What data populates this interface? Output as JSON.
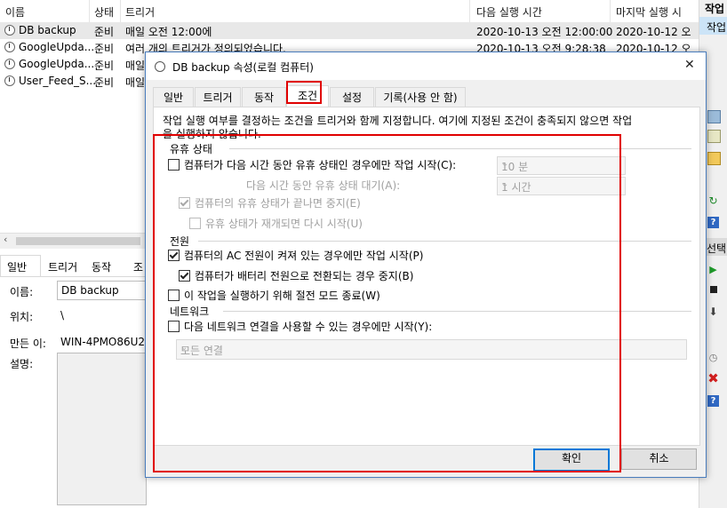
{
  "task_list": {
    "columns": [
      "이름",
      "상태",
      "트리거",
      "다음 실행 시간",
      "마지막 실행 시"
    ],
    "rows": [
      {
        "name": "DB backup",
        "status": "준비",
        "trigger": "매일 오전 12:00에",
        "next_run": "2020-10-13 오전 12:00:00",
        "last_run": "2020-10-12 오"
      },
      {
        "name": "GoogleUpda...",
        "status": "준비",
        "trigger": "여러 개의 트리거가 정의되었습니다.",
        "next_run": "2020-10-13 오전 9:28:38",
        "last_run": "2020-10-12 오"
      },
      {
        "name": "GoogleUpda...",
        "status": "준비",
        "trigger": "매일",
        "next_run": "",
        "last_run": ""
      },
      {
        "name": "User_Feed_S...",
        "status": "준비",
        "trigger": "매일",
        "next_run": "",
        "last_run": ""
      }
    ]
  },
  "actions_pane": {
    "header": "작업",
    "sub_header": "작업",
    "selected_header": "선택"
  },
  "lower_pane": {
    "tabs": [
      "일반",
      "트리거",
      "동작",
      "조"
    ],
    "fields": {
      "name_label": "이름:",
      "name_value": "DB backup",
      "location_label": "위치:",
      "location_value": "\\",
      "author_label": "만든 이:",
      "author_value": "WIN-4PMO86U2D",
      "description_label": "설명:"
    }
  },
  "dialog": {
    "title": "DB backup 속성(로컬 컴퓨터)",
    "close_glyph": "✕",
    "tabs": [
      "일반",
      "트리거",
      "동작",
      "조건",
      "설정",
      "기록(사용 안 함)"
    ],
    "active_tab": "조건",
    "intro_line1": "작업 실행 여부를 결정하는 조건을 트리거와 함께 지정합니다. 여기에 지정된 조건이 충족되지 않으면 작업",
    "intro_line2": "을 실행하지 않습니다.",
    "idle": {
      "group": "유휴 상태",
      "start_only_if_idle": "컴퓨터가 다음 시간 동안 유휴 상태인 경우에만 작업 시작(C):",
      "idle_duration": "10 분",
      "wait_for_idle": "다음 시간 동안 유휴 상태 대기(A):",
      "wait_duration": "1 시간",
      "stop_if_not_idle": "컴퓨터의 유휴 상태가 끝나면 중지(E)",
      "restart_if_idle_resumes": "유휴 상태가 재개되면 다시 시작(U)"
    },
    "power": {
      "group": "전원",
      "ac_only": "컴퓨터의 AC 전원이 켜져 있는 경우에만 작업 시작(P)",
      "stop_on_battery": "컴퓨터가 배터리 전원으로 전환되는 경우 중지(B)",
      "wake_to_run": "이 작업을 실행하기 위해 절전 모드 종료(W)"
    },
    "network": {
      "group": "네트워크",
      "start_only_if_network": "다음 네트워크 연결을 사용할 수 있는 경우에만 시작(Y):",
      "connection": "모든 연결"
    },
    "buttons": {
      "ok": "확인",
      "cancel": "취소"
    }
  }
}
